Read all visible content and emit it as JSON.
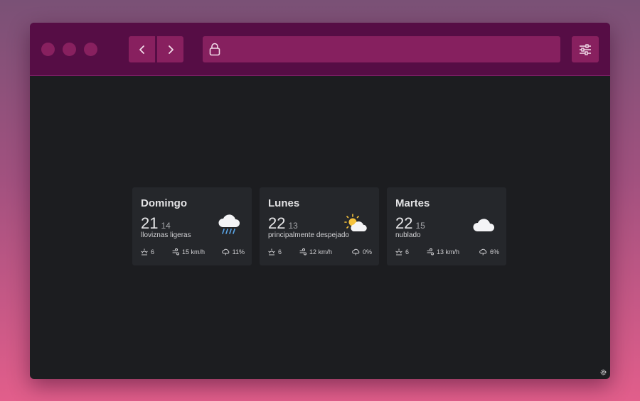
{
  "browser": {
    "url_value": "",
    "icons": {
      "back": "chevron-left-icon",
      "forward": "chevron-right-icon",
      "lock": "lock-icon",
      "settings": "sliders-icon",
      "corner": "gear-icon"
    }
  },
  "forecast": [
    {
      "day": "Domingo",
      "max": "21",
      "min": "14",
      "description": "lloviznas ligeras",
      "icon": "rain-cloud-icon",
      "uv": "6",
      "wind": "15 km/h",
      "precip": "11%"
    },
    {
      "day": "Lunes",
      "max": "22",
      "min": "13",
      "description": "principalmente despejado",
      "icon": "partly-sunny-icon",
      "uv": "6",
      "wind": "12 km/h",
      "precip": "0%"
    },
    {
      "day": "Martes",
      "max": "22",
      "min": "15",
      "description": "nublado",
      "icon": "cloud-icon",
      "uv": "6",
      "wind": "13 km/h",
      "precip": "6%"
    }
  ],
  "colors": {
    "titlebar": "#560d45",
    "accent": "#88205f",
    "page_bg": "#1c1d20",
    "card_bg": "#25272b",
    "rain": "#5aa6e8",
    "sun": "#f5c23c"
  }
}
